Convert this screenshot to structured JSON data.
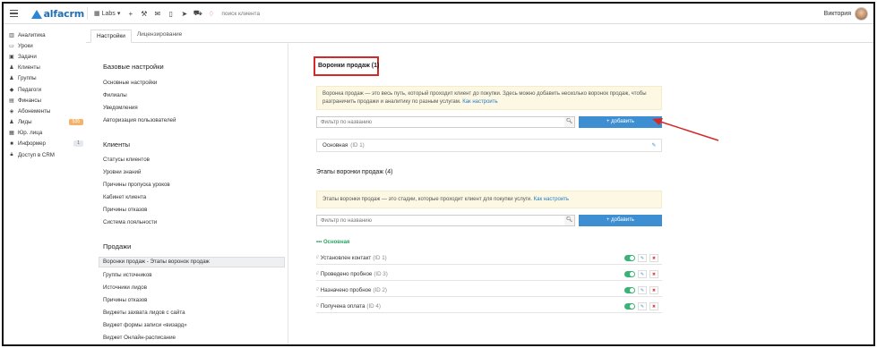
{
  "topbar": {
    "logo": "alfacrm",
    "labs_label": "Labs",
    "search_placeholder": "поиск клиента",
    "user_name": "Виктория"
  },
  "sidebar": {
    "items": [
      {
        "label": "Аналитика",
        "icon": "chart-icon"
      },
      {
        "label": "Уроки",
        "icon": "calendar-icon"
      },
      {
        "label": "Задачи",
        "icon": "tasks-icon"
      },
      {
        "label": "Клиенты",
        "icon": "user-icon"
      },
      {
        "label": "Группы",
        "icon": "users-icon"
      },
      {
        "label": "Педагоги",
        "icon": "graduation-icon"
      },
      {
        "label": "Финансы",
        "icon": "money-icon"
      },
      {
        "label": "Абонементы",
        "icon": "tag-icon"
      },
      {
        "label": "Лиды",
        "icon": "user-plus-icon",
        "badge": "535",
        "badge_color": "#f5b26b"
      },
      {
        "label": "Юр. лица",
        "icon": "building-icon"
      },
      {
        "label": "Информер",
        "icon": "bell-icon",
        "badge": "1",
        "badge_color": "#e5e9ee"
      },
      {
        "label": "Доступ в CRM",
        "icon": "lock-icon"
      }
    ]
  },
  "tabs": [
    "Настройки",
    "Лицензирование"
  ],
  "settings": {
    "basic_title": "Базовые настройки",
    "basic_links": [
      "Основные настройки",
      "Филиалы",
      "Уведомления",
      "Авторизация пользователей"
    ],
    "clients_title": "Клиенты",
    "clients_links": [
      "Статусы клиентов",
      "Уровни знаний",
      "Причины пропуска уроков",
      "Кабинет клиента",
      "Причины отказов",
      "Система лояльности"
    ],
    "sales_title": "Продажи",
    "sales_links": [
      "Воронки продаж - Этапы воронок продаж",
      "Группы источников",
      "Источники лидов",
      "Причины отказов",
      "Виджеты захвата лидов с сайта",
      "Виджет формы записи «визард»",
      "Виджет Онлайн-расписание"
    ]
  },
  "funnels": {
    "title": "Воронки продаж (1)",
    "notice_text": "Воронка продаж — это весь путь, который проходит клиент до покупки. Здесь можно добавить несколько воронок продаж, чтобы разграничить продажи и аналитику по разным услугам.",
    "notice_link": "Как настроить",
    "filter_placeholder": "Фильтр по названию",
    "add_label": "+ добавить",
    "items": [
      {
        "name": "Основная",
        "id": "(ID 1)"
      }
    ]
  },
  "stages": {
    "title": "Этапы воронки продаж (4)",
    "notice_text": "Этапы воронки продаж — это стадии, которые проходит клиент для покупки услуги.",
    "notice_link": "Как настроить",
    "filter_placeholder": "Фильтр по названию",
    "add_label": "+ добавить",
    "group_name": "••• Основная",
    "items": [
      {
        "name": "Установлен контакт",
        "id": "(ID 1)"
      },
      {
        "name": "Проведено пробное",
        "id": "(ID 3)"
      },
      {
        "name": "Назначено пробное",
        "id": "(ID 2)"
      },
      {
        "name": "Получена оплата",
        "id": "(ID 4)"
      }
    ]
  },
  "colors": {
    "accent": "#3d8fd1",
    "highlight": "#d62828",
    "toggle_on": "#3bb376",
    "notice_bg": "#fcf8e3"
  }
}
